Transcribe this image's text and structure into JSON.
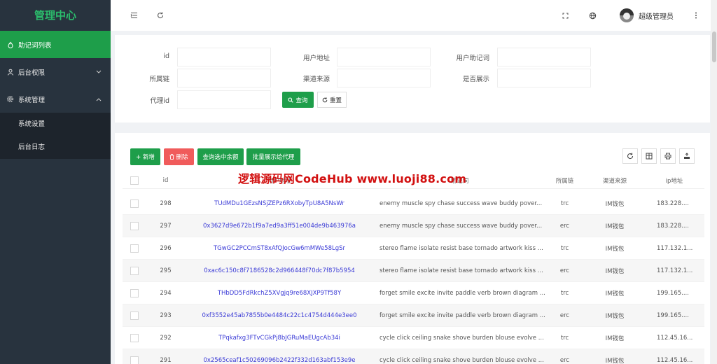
{
  "app": {
    "title": "管理中心"
  },
  "sidebar": {
    "items": [
      {
        "label": "助记词列表",
        "icon": "fire-icon",
        "active": true
      },
      {
        "label": "后台权限",
        "icon": "user-icon",
        "expanded": false
      },
      {
        "label": "系统管理",
        "icon": "gear-icon",
        "expanded": true
      }
    ],
    "sub_items": [
      {
        "label": "系统设置"
      },
      {
        "label": "后台日志"
      }
    ]
  },
  "header": {
    "user_name": "超级管理员",
    "icons": [
      "menu-fold-icon",
      "refresh-icon",
      "fullscreen-icon",
      "globe-icon",
      "more-icon"
    ]
  },
  "search": {
    "fields": [
      {
        "label": "id",
        "value": ""
      },
      {
        "label": "用户地址",
        "value": ""
      },
      {
        "label": "用户助记词",
        "value": ""
      },
      {
        "label": "所属链",
        "value": ""
      },
      {
        "label": "渠道来源",
        "value": ""
      },
      {
        "label": "是否展示",
        "value": ""
      },
      {
        "label": "代理id",
        "value": ""
      }
    ],
    "query_label": "查询",
    "reset_label": "重置"
  },
  "toolbar": {
    "add_label": "+ 新增",
    "delete_label": "删除",
    "query_selected_label": "查询选中余额",
    "batch_show_label": "批量展示给代理"
  },
  "colors": {
    "primary": "#1e9e4a",
    "danger": "#f05b5b",
    "sidebar": "#28333e",
    "link": "#3a3ad6"
  },
  "table": {
    "columns": [
      "id",
      "用户地址",
      "助记词",
      "所属链",
      "渠道来源",
      "ip地址"
    ],
    "rows": [
      {
        "id": "298",
        "address": "TUdMDu1GEzsNSjZEPz6RXobyTpU8A5NsWr",
        "mnemonic": "enemy muscle spy chase success wave buddy pover...",
        "chain": "trc",
        "source": "IM钱包",
        "ip": "183.228...."
      },
      {
        "id": "297",
        "address": "0x3627d9e672b1f9a7ed9a3ff51e004de9b463976a",
        "mnemonic": "enemy muscle spy chase success wave buddy pover...",
        "chain": "erc",
        "source": "IM钱包",
        "ip": "183.228...."
      },
      {
        "id": "296",
        "address": "TGwGC2PCCmST8xAfQJocGw6mMWe58LgSr",
        "mnemonic": "stereo flame isolate resist base tornado artwork kiss ...",
        "chain": "trc",
        "source": "IM钱包",
        "ip": "117.132.1..."
      },
      {
        "id": "295",
        "address": "0xac6c150c8f7186528c2d966448f70dc7f87b5954",
        "mnemonic": "stereo flame isolate resist base tornado artwork kiss ...",
        "chain": "erc",
        "source": "IM钱包",
        "ip": "117.132.1..."
      },
      {
        "id": "294",
        "address": "THbDD5FdRkchZ5XVgjq9re68XJXP9Tf58Y",
        "mnemonic": "forget smile excite invite paddle verb brown diagram ...",
        "chain": "trc",
        "source": "IM钱包",
        "ip": "199.165...."
      },
      {
        "id": "293",
        "address": "0xf3552e45ab7855b0e4484c22c1c4754d444e3ee0",
        "mnemonic": "forget smile excite invite paddle verb brown diagram ...",
        "chain": "erc",
        "source": "IM钱包",
        "ip": "199.165...."
      },
      {
        "id": "292",
        "address": "TPqkafxg3FTvCGkPj8bJGRuMaEUgcAb34i",
        "mnemonic": "cycle click ceiling snake shove burden blouse evolve ...",
        "chain": "trc",
        "source": "IM钱包",
        "ip": "112.45.16..."
      },
      {
        "id": "291",
        "address": "0x2565ceaf1c50269096b2422f332d163abf153e9e",
        "mnemonic": "cycle click ceiling snake shove burden blouse evolve ...",
        "chain": "erc",
        "source": "IM钱包",
        "ip": "112.45.16..."
      }
    ]
  },
  "watermark": {
    "text": "逻辑源码网CodeHub  www.luoji88.com"
  }
}
